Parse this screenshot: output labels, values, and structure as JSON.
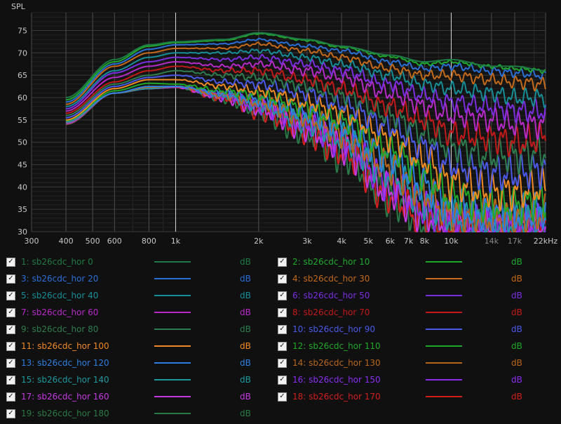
{
  "chart_data": {
    "type": "line",
    "ylabel": "SPL",
    "x_scale": "log",
    "xlim": [
      300,
      22000
    ],
    "ylim": [
      30,
      79
    ],
    "grid": true,
    "x_ticks": [
      {
        "value": 300,
        "label": "300"
      },
      {
        "value": 400,
        "label": "400"
      },
      {
        "value": 500,
        "label": "500"
      },
      {
        "value": 600,
        "label": "600"
      },
      {
        "value": 800,
        "label": "800"
      },
      {
        "value": 1000,
        "label": "1k"
      },
      {
        "value": 2000,
        "label": "2k"
      },
      {
        "value": 3000,
        "label": "3k"
      },
      {
        "value": 4000,
        "label": "4k"
      },
      {
        "value": 5000,
        "label": "5k"
      },
      {
        "value": 6000,
        "label": "6k"
      },
      {
        "value": 7000,
        "label": "7k"
      },
      {
        "value": 8000,
        "label": "8k"
      },
      {
        "value": 10000,
        "label": "10k"
      },
      {
        "value": 14000,
        "label": "14k"
      },
      {
        "value": 17000,
        "label": "17k"
      },
      {
        "value": 22000,
        "label": "22kHz"
      }
    ],
    "y_ticks": [
      30,
      35,
      40,
      45,
      50,
      55,
      60,
      65,
      70,
      75
    ],
    "series": [
      {
        "name": "1: sb26cdc_hor 0",
        "color": "#1f7a46",
        "unit": "dB",
        "x": [
          400,
          600,
          800,
          1000,
          1500,
          2000,
          3000,
          4000,
          6000,
          8000,
          10000,
          14000,
          17000,
          22000
        ],
        "y": [
          60,
          68.5,
          71.8,
          72.5,
          73,
          74.5,
          73,
          71.5,
          69.5,
          68,
          68.5,
          67,
          67,
          66
        ]
      },
      {
        "name": "2: sb26cdc_hor 10",
        "color": "#1faa2e",
        "unit": "dB",
        "x": [
          400,
          600,
          800,
          1000,
          1500,
          2000,
          3000,
          4000,
          6000,
          8000,
          10000,
          14000,
          17000,
          22000
        ],
        "y": [
          59.5,
          68,
          71.5,
          72.3,
          72.8,
          74.3,
          72.8,
          71.3,
          69.2,
          67.5,
          68,
          67,
          66.5,
          66
        ]
      },
      {
        "name": "3: sb26cdc_hor 20",
        "color": "#2a6fd6",
        "unit": "dB",
        "x": [
          400,
          600,
          800,
          1000,
          1500,
          2000,
          3000,
          4000,
          6000,
          8000,
          10000,
          14000,
          17000,
          22000
        ],
        "y": [
          59,
          67.5,
          70.8,
          71.8,
          72,
          73,
          71.5,
          70.5,
          68,
          66.5,
          67,
          66,
          65.5,
          65
        ]
      },
      {
        "name": "4: sb26cdc_hor 30",
        "color": "#c46a1a",
        "unit": "dB",
        "x": [
          400,
          600,
          800,
          1000,
          1500,
          2000,
          3000,
          4000,
          6000,
          8000,
          10000,
          14000,
          17000,
          22000
        ],
        "y": [
          58.5,
          67,
          70,
          71,
          71,
          72,
          70.5,
          69,
          66.5,
          65,
          65,
          64,
          63.5,
          63
        ]
      },
      {
        "name": "5: sb26cdc_hor 40",
        "color": "#168e98",
        "unit": "dB",
        "x": [
          400,
          600,
          800,
          1000,
          1500,
          2000,
          3000,
          4000,
          6000,
          8000,
          10000,
          14000,
          17000,
          22000
        ],
        "y": [
          58,
          66,
          69,
          70,
          70,
          70.5,
          69,
          67.5,
          65,
          63,
          62,
          61,
          60,
          60
        ]
      },
      {
        "name": "6: sb26cdc_hor 50",
        "color": "#7a2ee0",
        "unit": "dB",
        "x": [
          400,
          600,
          800,
          1000,
          1500,
          2000,
          3000,
          4000,
          6000,
          8000,
          10000,
          14000,
          17000,
          22000
        ],
        "y": [
          57.5,
          65.5,
          68,
          69,
          68.5,
          69,
          67.5,
          66,
          63,
          60.5,
          59,
          58,
          57,
          57
        ]
      },
      {
        "name": "7: sb26cdc_hor 60",
        "color": "#b62ac8",
        "unit": "dB",
        "x": [
          400,
          600,
          800,
          1000,
          1500,
          2000,
          3000,
          4000,
          6000,
          8000,
          10000,
          14000,
          17000,
          22000
        ],
        "y": [
          57,
          64.5,
          67,
          68,
          67,
          67.5,
          66,
          64.5,
          61,
          58,
          56,
          55,
          54,
          54
        ]
      },
      {
        "name": "8: sb26cdc_hor 70",
        "color": "#c21a1a",
        "unit": "dB",
        "x": [
          400,
          600,
          800,
          1000,
          1500,
          2000,
          3000,
          4000,
          6000,
          8000,
          10000,
          14000,
          17000,
          22000
        ],
        "y": [
          56.5,
          63.5,
          66,
          67,
          66,
          66,
          64,
          62,
          58,
          55,
          52,
          51,
          50,
          51
        ]
      },
      {
        "name": "9: sb26cdc_hor 80",
        "color": "#2e7d4e",
        "unit": "dB",
        "x": [
          400,
          600,
          800,
          1000,
          1500,
          2000,
          3000,
          4000,
          6000,
          8000,
          10000,
          14000,
          17000,
          22000
        ],
        "y": [
          56,
          63,
          65,
          66,
          65,
          64.5,
          62.5,
          60.5,
          56,
          52,
          49,
          47,
          47,
          48
        ]
      },
      {
        "name": "10: sb26cdc_hor 90",
        "color": "#4a5ae8",
        "unit": "dB",
        "x": [
          400,
          600,
          800,
          1000,
          1500,
          2000,
          3000,
          4000,
          6000,
          8000,
          10000,
          14000,
          17000,
          22000
        ],
        "y": [
          55.5,
          62.5,
          64.5,
          65,
          63.5,
          63,
          61,
          58.5,
          53.5,
          49,
          45,
          43,
          43,
          44
        ]
      },
      {
        "name": "11: sb26cdc_hor 100",
        "color": "#f08a24",
        "unit": "dB",
        "x": [
          400,
          600,
          800,
          1000,
          1500,
          2000,
          3000,
          4000,
          6000,
          8000,
          10000,
          14000,
          17000,
          22000
        ],
        "y": [
          55,
          62,
          64,
          64,
          62.5,
          61.5,
          59,
          56.5,
          51,
          46,
          41,
          39,
          39,
          40
        ]
      },
      {
        "name": "12: sb26cdc_hor 110",
        "color": "#21a829",
        "unit": "dB",
        "x": [
          400,
          600,
          800,
          1000,
          1500,
          2000,
          3000,
          4000,
          6000,
          8000,
          10000,
          14000,
          17000,
          22000
        ],
        "y": [
          54.8,
          61.5,
          63.2,
          63,
          61.5,
          60.5,
          57.5,
          55,
          48.5,
          43,
          38,
          36,
          36,
          37
        ]
      },
      {
        "name": "13: sb26cdc_hor 120",
        "color": "#2e7fe0",
        "unit": "dB",
        "x": [
          400,
          600,
          800,
          1000,
          1500,
          2000,
          3000,
          4000,
          6000,
          8000,
          10000,
          14000,
          17000,
          22000
        ],
        "y": [
          54.6,
          61,
          62.5,
          62.5,
          61,
          59.5,
          56.5,
          53.5,
          46.5,
          40.5,
          35.5,
          34,
          34,
          35
        ]
      },
      {
        "name": "14: sb26cdc_hor 130",
        "color": "#b8661c",
        "unit": "dB",
        "x": [
          400,
          600,
          800,
          1000,
          1500,
          2000,
          3000,
          4000,
          6000,
          8000,
          10000,
          14000,
          17000,
          22000
        ],
        "y": [
          54.5,
          61,
          62.3,
          62.5,
          60.5,
          59,
          55.5,
          52,
          44.5,
          38.5,
          34,
          33,
          33,
          34
        ]
      },
      {
        "name": "15: sb26cdc_hor 140",
        "color": "#1d9aa0",
        "unit": "dB",
        "x": [
          400,
          600,
          800,
          1000,
          1500,
          2000,
          3000,
          4000,
          6000,
          8000,
          10000,
          14000,
          17000,
          22000
        ],
        "y": [
          54.4,
          61,
          62,
          62.5,
          60.5,
          58.5,
          54.5,
          51,
          43,
          37,
          33,
          32,
          32,
          33
        ]
      },
      {
        "name": "16: sb26cdc_hor 150",
        "color": "#8a2ef0",
        "unit": "dB",
        "x": [
          400,
          600,
          800,
          1000,
          1500,
          2000,
          3000,
          4000,
          6000,
          8000,
          10000,
          14000,
          17000,
          22000
        ],
        "y": [
          54.3,
          61,
          62,
          62.5,
          60.5,
          58,
          54,
          50,
          41,
          35,
          32,
          31.5,
          31.5,
          32
        ]
      },
      {
        "name": "17: sb26cdc_hor 160",
        "color": "#c43ae0",
        "unit": "dB",
        "x": [
          400,
          600,
          800,
          1000,
          1500,
          2000,
          3000,
          4000,
          6000,
          8000,
          10000,
          14000,
          17000,
          22000
        ],
        "y": [
          54.2,
          61,
          62,
          62.3,
          60,
          57.5,
          53,
          49,
          39,
          33.5,
          31.5,
          31,
          31,
          31.5
        ]
      },
      {
        "name": "18: sb26cdc_hor 170",
        "color": "#d01f1f",
        "unit": "dB",
        "x": [
          400,
          600,
          800,
          1000,
          1500,
          2000,
          3000,
          4000,
          6000,
          8000,
          10000,
          14000,
          17000,
          22000
        ],
        "y": [
          54.1,
          61,
          62,
          62.3,
          60,
          57,
          52.5,
          48,
          38,
          32.5,
          31,
          30.5,
          30.5,
          31
        ]
      },
      {
        "name": "19: sb26cdc_hor 180",
        "color": "#2a7a48",
        "unit": "dB",
        "x": [
          400,
          600,
          800,
          1000,
          1500,
          2000,
          3000,
          4000,
          6000,
          8000,
          10000,
          14000,
          17000,
          22000
        ],
        "y": [
          54,
          61,
          62,
          62.3,
          60,
          57,
          52,
          47.5,
          37.5,
          32,
          30.8,
          30.5,
          30.5,
          31
        ]
      }
    ]
  },
  "legend": {
    "check_mark": "✓"
  }
}
